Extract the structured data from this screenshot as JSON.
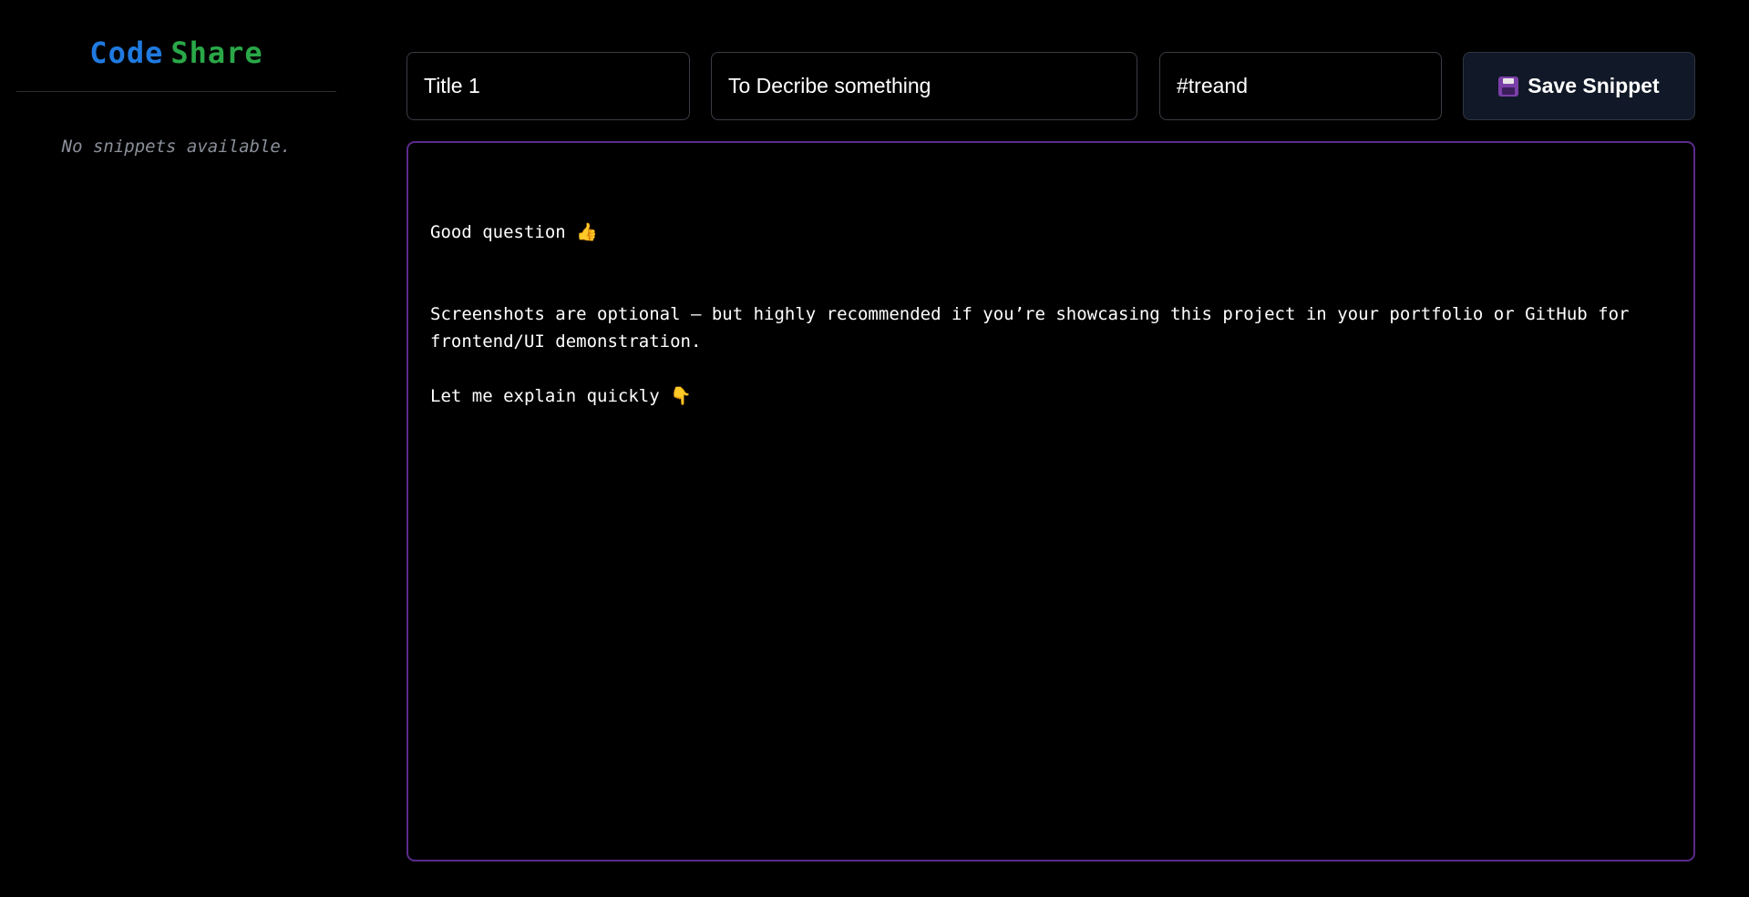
{
  "app": {
    "logo_code": "Code",
    "logo_share": "Share",
    "colors": {
      "logo_code": "#1f7ae0",
      "logo_share": "#2aa848",
      "editor_border": "#5b2a8c",
      "save_button_bg": "#111827"
    }
  },
  "sidebar": {
    "empty_message": "No snippets available."
  },
  "form": {
    "title_value": "Title 1",
    "description_value": "To Decribe something",
    "tag_value": "#treand",
    "save_label": "Save Snippet",
    "save_icon": "floppy-disk-icon"
  },
  "editor": {
    "content": "Good question 👍\n\n\nScreenshots are optional — but highly recommended if you’re showcasing this project in your portfolio or GitHub for frontend/UI demonstration.\n\nLet me explain quickly 👇"
  }
}
